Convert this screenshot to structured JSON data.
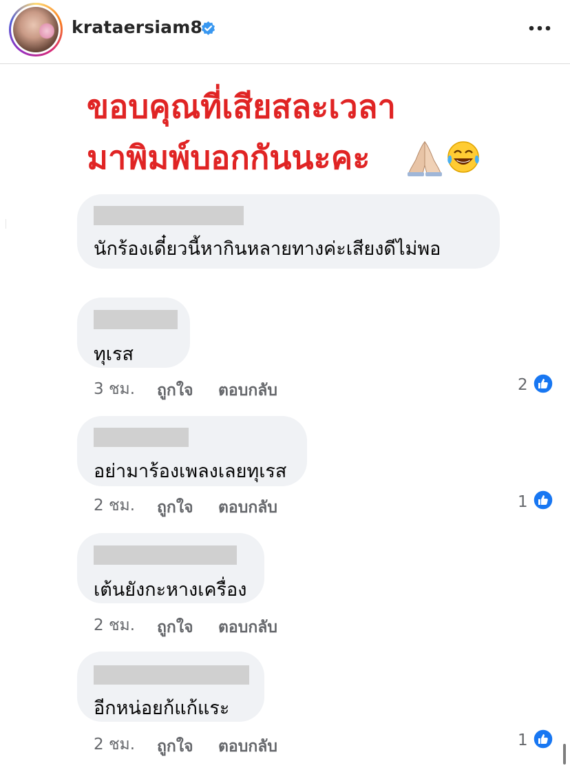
{
  "header": {
    "username": "krataersiam8",
    "verified_icon": "verified-badge-icon",
    "more_icon": "more-options-icon",
    "brand_color": "#3897f0"
  },
  "post": {
    "title_line1": "ขอบคุณที่เสียสละเวลา",
    "title_line2": "มาพิมพ์บอกกันนะคะ",
    "title_emojis": [
      "praying-hands-icon",
      "tears-of-joy-icon"
    ],
    "title_color": "#e02424"
  },
  "comments": [
    {
      "text": "นักร้องเดี๋ยวนี้หากินหลายทางค่ะเสียงดีไม่พอ",
      "time": "",
      "like_label": "",
      "reply_label": "",
      "likes": ""
    },
    {
      "text": "ทุเรส",
      "time": "3 ชม.",
      "like_label": "ถูกใจ",
      "reply_label": "ตอบกลับ",
      "likes": "2"
    },
    {
      "text": "อย่ามาร้องเพลงเลยทุเรส",
      "time": "2 ชม.",
      "like_label": "ถูกใจ",
      "reply_label": "ตอบกลับ",
      "likes": "1"
    },
    {
      "text": "เต้นยังกะหางเครื่อง",
      "time": "2 ชม.",
      "like_label": "ถูกใจ",
      "reply_label": "ตอบกลับ",
      "likes": ""
    },
    {
      "text": "อีกหน่อยก้แก้แระ",
      "time": "2 ชม.",
      "like_label": "ถูกใจ",
      "reply_label": "ตอบกลับ",
      "likes": "1"
    }
  ],
  "like_icon_color": "#1877f2"
}
